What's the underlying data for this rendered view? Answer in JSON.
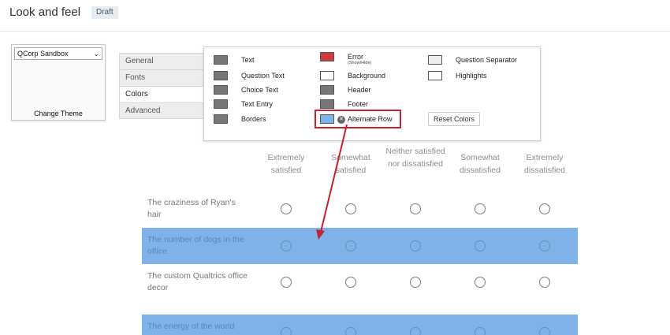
{
  "header": {
    "title": "Look and feel",
    "badge": "Draft"
  },
  "theme": {
    "selected": "QCorp Sandbox",
    "change_label": "Change Theme"
  },
  "tabs": [
    "General",
    "Fonts",
    "Colors",
    "Advanced"
  ],
  "colors": {
    "text": {
      "label": "Text",
      "color": "#777777"
    },
    "question_text": {
      "label": "Question Text",
      "color": "#777777"
    },
    "choice_text": {
      "label": "Choice Text",
      "color": "#777777"
    },
    "text_entry": {
      "label": "Text Entry",
      "color": "#777777"
    },
    "borders": {
      "label": "Borders",
      "color": "#777777"
    },
    "error": {
      "label": "Error",
      "sublabel": "(Show/Hide)",
      "color": "#d13b3b"
    },
    "background": {
      "label": "Background",
      "color": "#ffffff"
    },
    "header": {
      "label": "Header",
      "color": "#777777"
    },
    "footer": {
      "label": "Footer",
      "color": "#777777"
    },
    "alternate_row": {
      "label": "Alternate Row",
      "color": "#7fb2e8"
    },
    "question_separator": {
      "label": "Question Separator",
      "color": "#eeeeee"
    },
    "highlights": {
      "label": "Highlights",
      "color": "#ffffff"
    }
  },
  "reset_label": "Reset Colors",
  "survey": {
    "columns": [
      "Extremely satisfied",
      "Somewhat satisfied",
      "Neither satisfied nor dissatisfied",
      "Somewhat dissatisfied",
      "Extremely dissatisfied"
    ],
    "rows": [
      {
        "label": "The craziness of Ryan's hair"
      },
      {
        "label": "The number of dogs in the office"
      },
      {
        "label": "The custom Qualtrics office decor"
      },
      {
        "label": "The energy of the world"
      }
    ]
  },
  "accent": "#c0242c"
}
